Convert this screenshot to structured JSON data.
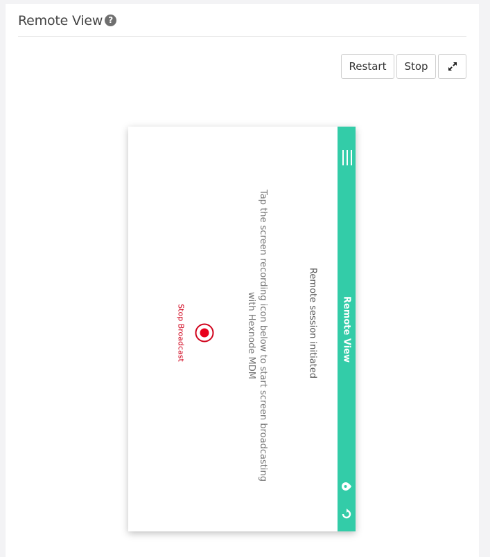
{
  "header": {
    "title": "Remote View",
    "help_icon": "question-circle-icon",
    "help_glyph": "?"
  },
  "toolbar": {
    "restart_label": "Restart",
    "stop_label": "Stop",
    "expand_icon": "expand-arrows-icon"
  },
  "device": {
    "appbar_title": "Remote View",
    "menu_icon": "menu-lines-icon",
    "pin_icon": "location-pin-icon",
    "refresh_icon": "refresh-icon",
    "session_status": "Remote session initiated",
    "instruction_line1": "Tap the screen recording icon below to start screen broadcasting",
    "instruction_line2": "with Hexnode MDM",
    "record_icon": "record-icon",
    "broadcast_label": "Stop Broadcast"
  },
  "colors": {
    "appbar": "#33cca8",
    "record": "#d0021b",
    "title_text": "#444444"
  }
}
